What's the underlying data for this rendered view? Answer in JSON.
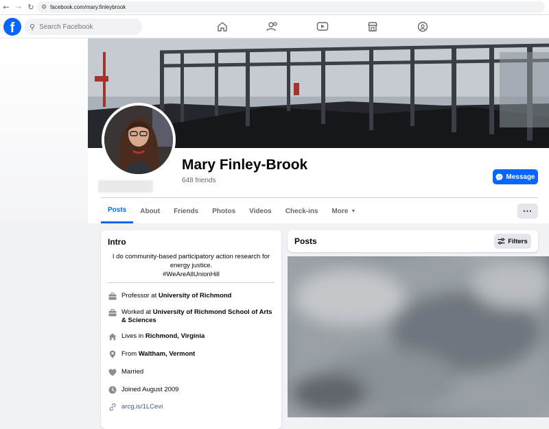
{
  "browser": {
    "url": "facebook.com/mary.finleybrook"
  },
  "topbar": {
    "search_placeholder": "Search Facebook",
    "nav_icons": [
      "home-icon",
      "friends-icon",
      "watch-icon",
      "marketplace-icon",
      "groups-icon"
    ]
  },
  "profile": {
    "name": "Mary Finley-Brook",
    "friends": "648 friends",
    "message_label": "Message",
    "more_label": "···"
  },
  "tabs": {
    "items": [
      "Posts",
      "About",
      "Friends",
      "Photos",
      "Videos",
      "Check-ins"
    ],
    "more": "More",
    "active": "Posts"
  },
  "intro": {
    "title": "Intro",
    "bio_line1": "I do community-based participatory action research for",
    "bio_line2": "energy justice.",
    "bio_line3": "#WeAreAllUnionHill",
    "work1_prefix": "Professor at ",
    "work1_place": "University of Richmond",
    "work2_prefix": "Worked at ",
    "work2_place": "University of Richmond School of Arts & Sciences",
    "lives_prefix": "Lives in ",
    "lives_place": "Richmond, Virginia",
    "from_prefix": "From ",
    "from_place": "Waltham, Vermont",
    "relationship": "Married",
    "joined": "Joined August 2009",
    "link": "arcg.is/1LCevi"
  },
  "posts": {
    "title": "Posts",
    "filters_label": "Filters"
  },
  "colors": {
    "brand": "#0866ff",
    "background": "#f0f2f5",
    "secondary_text": "#65676b"
  }
}
